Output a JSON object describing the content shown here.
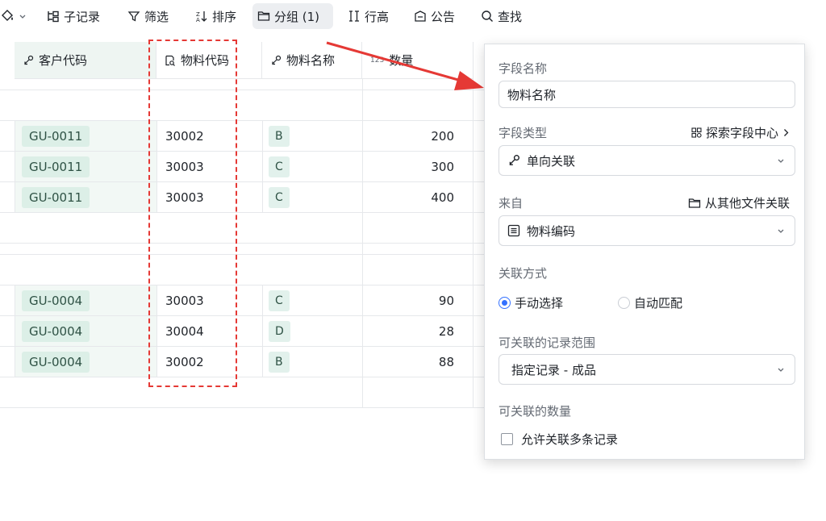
{
  "toolbar": {
    "sub_record": "子记录",
    "filter": "筛选",
    "sort": "排序",
    "group": "分组 (1)",
    "row_height": "行高",
    "notice": "公告",
    "find": "查找"
  },
  "table": {
    "columns": [
      {
        "label": "客户代码",
        "icon": "link-icon"
      },
      {
        "label": "物料代码",
        "icon": "lookup-icon"
      },
      {
        "label": "物料名称",
        "icon": "link-icon"
      },
      {
        "label": "数量",
        "icon": "number-icon",
        "icon_text": "123"
      }
    ],
    "groups": [
      {
        "rows": [
          {
            "customer": "GU-0011",
            "code": "30002",
            "name": "B",
            "qty": "200"
          },
          {
            "customer": "GU-0011",
            "code": "30003",
            "name": "C",
            "qty": "300"
          },
          {
            "customer": "GU-0011",
            "code": "30003",
            "name": "C",
            "qty": "400"
          }
        ]
      },
      {
        "rows": [
          {
            "customer": "GU-0004",
            "code": "30003",
            "name": "C",
            "qty": "90"
          },
          {
            "customer": "GU-0004",
            "code": "30004",
            "name": "D",
            "qty": "28"
          },
          {
            "customer": "GU-0004",
            "code": "30002",
            "name": "B",
            "qty": "88"
          }
        ]
      }
    ]
  },
  "panel": {
    "field_name_label": "字段名称",
    "field_name_value": "物料名称",
    "field_type_label": "字段类型",
    "explore_link": "探索字段中心",
    "field_type_value": "单向关联",
    "source_label": "来自",
    "other_file_link": "从其他文件关联",
    "source_value": "物料编码",
    "link_mode_label": "关联方式",
    "manual_option": "手动选择",
    "auto_option": "自动匹配",
    "manual_selected": true,
    "range_label": "可关联的记录范围",
    "range_value": "指定记录 - 成品",
    "count_label": "可关联的数量",
    "allow_multi_label": "允许关联多条记录",
    "allow_multi_checked": false
  },
  "colors": {
    "accent": "#3370ff",
    "highlight": "#e53935",
    "tag_bg": "#dcefe7"
  }
}
